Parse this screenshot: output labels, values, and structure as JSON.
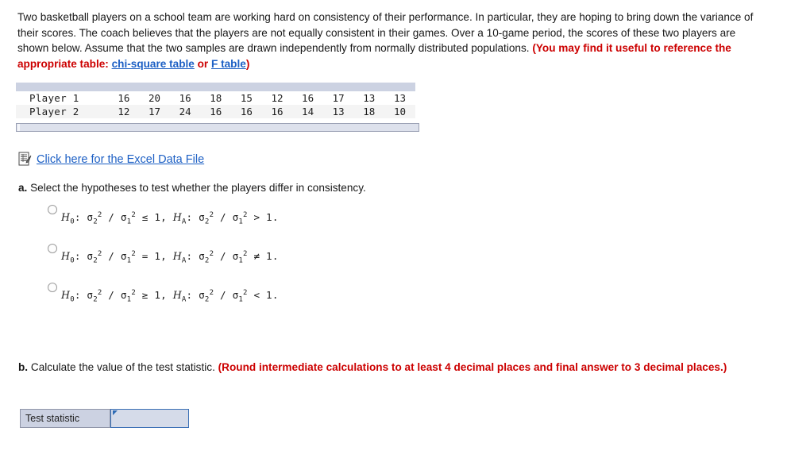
{
  "intro": {
    "text_part1": "Two basketball players on a school team are working hard on consistency of their performance. In particular, they are hoping to bring down the variance of their scores. The coach believes that the players are not equally consistent in their games. Over a 10-game period, the scores of these two players are shown below. Assume that the two samples are drawn independently from normally distributed populations. ",
    "note_open": "(You may find it useful to reference the appropriate table: ",
    "link_chi": "chi-square table",
    "note_or": " or ",
    "link_f": "F table",
    "note_close": ")"
  },
  "data_table": {
    "rows": [
      {
        "label": "Player 1",
        "values": [
          "16",
          "20",
          "16",
          "18",
          "15",
          "12",
          "16",
          "17",
          "13",
          "13"
        ]
      },
      {
        "label": "Player 2",
        "values": [
          "12",
          "17",
          "24",
          "16",
          "16",
          "16",
          "14",
          "13",
          "18",
          "10"
        ]
      }
    ]
  },
  "excel": {
    "icon": "spreadsheet-document-icon",
    "link_text": "Click here for the Excel Data File"
  },
  "part_a": {
    "letter": "a.",
    "prompt": " Select the hypotheses to test whether the players differ in consistency.",
    "options": [
      {
        "null_sign": "≤",
        "alt_sign": ">",
        "text": "H₀: σ₂² / σ₁² ≤ 1, HA: σ₂² / σ₁² > 1.",
        "selected": false
      },
      {
        "null_sign": "=",
        "alt_sign": "≠",
        "text": "H₀: σ₂² / σ₁² = 1, HA: σ₂² / σ₁² ≠ 1.",
        "selected": false
      },
      {
        "null_sign": "≥",
        "alt_sign": "<",
        "text": "H₀: σ₂² / σ₁² ≥ 1, HA: σ₂² / σ₁² < 1.",
        "selected": false
      }
    ]
  },
  "part_b": {
    "letter": "b.",
    "prompt": " Calculate the value of the test statistic. ",
    "note": "(Round intermediate calculations to at least 4 decimal places and final answer to 3 decimal places.)",
    "answer": {
      "label": "Test statistic",
      "value": "",
      "placeholder": ""
    }
  },
  "colors": {
    "link_blue": "#1c5fc4",
    "note_red": "#cc0000",
    "table_band": "#ccd2e2",
    "input_border": "#3a6fb5",
    "input_fill": "#d5dbe9"
  }
}
